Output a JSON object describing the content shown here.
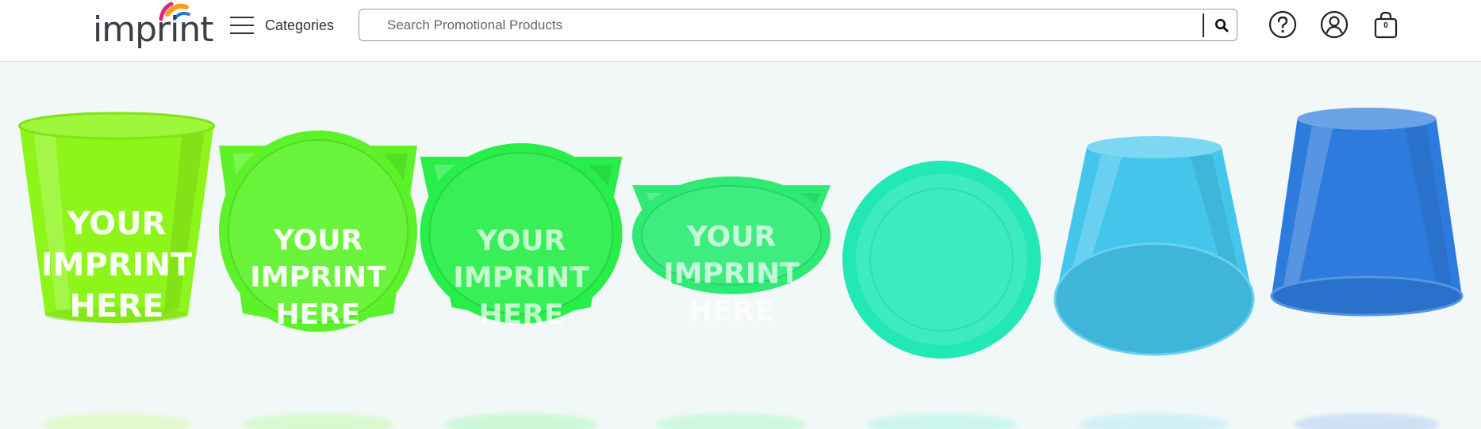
{
  "header": {
    "logo_text": "imprint",
    "categories_label": "Categories",
    "search": {
      "placeholder": "Search Promotional Products"
    },
    "cart_count": "0"
  },
  "hero": {
    "cups": [
      {
        "color": "#8ef51a",
        "imprint": [
          "YOUR",
          "IMPRINT",
          "HERE"
        ]
      },
      {
        "color": "#5cf22a",
        "imprint": [
          "YOUR",
          "IMPRINT",
          "HERE"
        ]
      },
      {
        "color": "#28ee4a",
        "imprint": [
          "YOUR",
          "IMPRINT",
          "HERE"
        ]
      },
      {
        "color": "#2eea74",
        "imprint": [
          "YOUR",
          "IMPRINT",
          "HERE"
        ]
      },
      {
        "color": "#22e8b6",
        "imprint": []
      },
      {
        "color": "#44c6ec",
        "imprint": []
      },
      {
        "color": "#2d7bdc",
        "imprint": []
      }
    ]
  },
  "colors": {
    "brand_orange": "#f7a11a",
    "brand_pink": "#e0267e",
    "brand_blue": "#2a78c8",
    "text_dark": "#333333"
  }
}
